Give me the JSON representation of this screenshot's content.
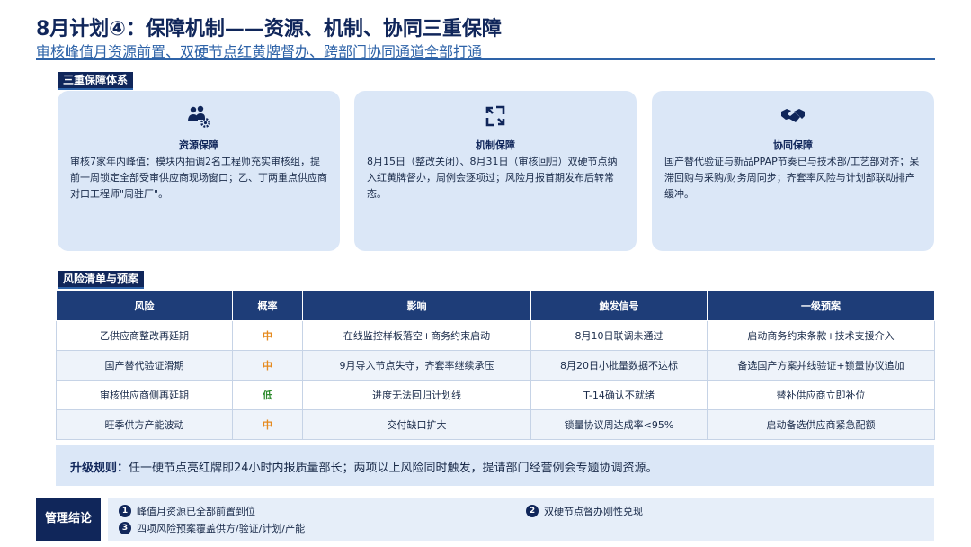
{
  "header": {
    "title": "8月计划④：保障机制——资源、机制、协同三重保障",
    "subtitle": "审核峰值月资源前置、双硬节点红黄牌督办、跨部门协同通道全部打通"
  },
  "pillars_section": {
    "label": "三重保障体系",
    "items": [
      {
        "icon": "team-gear-icon",
        "title": "资源保障",
        "body": "审核7家年内峰值：模块内抽调2名工程师充实审核组，提前一周锁定全部受审供应商现场窗口；乙、丁两重点供应商对口工程师\"周驻厂\"。"
      },
      {
        "icon": "cycle-arrows-icon",
        "title": "机制保障",
        "body": "8月15日（整改关闭）、8月31日（审核回归）双硬节点纳入红黄牌督办，周例会逐项过；风险月报首期发布后转常态。"
      },
      {
        "icon": "handshake-icon",
        "title": "协同保障",
        "body": "国产替代验证与新品PPAP节奏已与技术部/工艺部对齐；呆滞回购与采购/财务周同步；齐套率风险与计划部联动排产缓冲。"
      }
    ]
  },
  "risk_section": {
    "label": "风险清单与预案",
    "columns": [
      "风险",
      "概率",
      "影响",
      "触发信号",
      "一级预案"
    ],
    "rows": [
      {
        "risk": "乙供应商整改再延期",
        "prob": "中",
        "prob_color": "#e58a1f",
        "impact": "在线监控样板落空+商务约束启动",
        "signal": "8月10日联调未通过",
        "plan": "启动商务约束条款+技术支援介入"
      },
      {
        "risk": "国产替代验证滑期",
        "prob": "中",
        "prob_color": "#e58a1f",
        "impact": "9月导入节点失守，齐套率继续承压",
        "signal": "8月20日小批量数据不达标",
        "plan": "备选国产方案并线验证+锁量协议追加"
      },
      {
        "risk": "审核供应商侧再延期",
        "prob": "低",
        "prob_color": "#2e8b2e",
        "impact": "进度无法回归计划线",
        "signal": "T-14确认不就绪",
        "plan": "替补供应商立即补位"
      },
      {
        "risk": "旺季供方产能波动",
        "prob": "中",
        "prob_color": "#e58a1f",
        "impact": "交付缺口扩大",
        "signal": "锁量协议周达成率<95%",
        "plan": "启动备选供应商紧急配额"
      }
    ]
  },
  "escalation": {
    "label": "升级规则：",
    "text": "任一硬节点亮红牌即24小时内报质量部长；两项以上风险同时触发，提请部门经营例会专题协调资源。"
  },
  "conclusion": {
    "label": "管理结论",
    "items": [
      {
        "num": "1",
        "text": "峰值月资源已全部前置到位"
      },
      {
        "num": "2",
        "text": "双硬节点督办刚性兑现"
      },
      {
        "num": "3",
        "text": "四项风险预案覆盖供方/验证/计划/产能"
      }
    ]
  },
  "colors": {
    "navy": "#10265a",
    "accent_blue": "#2e63a8",
    "card_bg": "#dbe7f7",
    "medium": "#e58a1f",
    "low": "#2e8b2e"
  }
}
